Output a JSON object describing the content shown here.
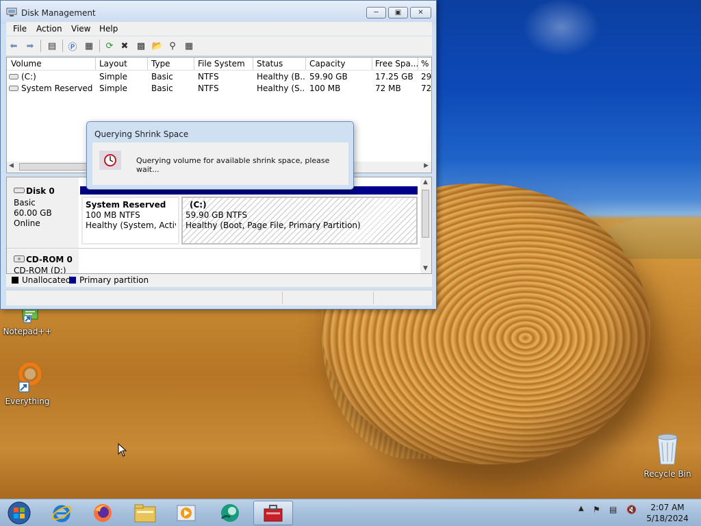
{
  "window": {
    "title": "Disk Management",
    "menu": [
      "File",
      "Action",
      "View",
      "Help"
    ],
    "columns": [
      "Volume",
      "Layout",
      "Type",
      "File System",
      "Status",
      "Capacity",
      "Free Spa...",
      "% F"
    ],
    "volumes": [
      {
        "volume": "(C:)",
        "layout": "Simple",
        "type": "Basic",
        "fs": "NTFS",
        "status": "Healthy (B...",
        "capacity": "59.90 GB",
        "free": "17.25 GB",
        "pct": "29"
      },
      {
        "volume": "System Reserved",
        "layout": "Simple",
        "type": "Basic",
        "fs": "NTFS",
        "status": "Healthy (S...",
        "capacity": "100 MB",
        "free": "72 MB",
        "pct": "72"
      }
    ],
    "disks": [
      {
        "name": "Disk 0",
        "kind": "Basic",
        "size": "60.00 GB",
        "state": "Online",
        "partitions": [
          {
            "name": "System Reserved",
            "size": "100 MB NTFS",
            "status": "Healthy (System, Active,"
          },
          {
            "name": "(C:)",
            "size": "59.90 GB NTFS",
            "status": "Healthy (Boot, Page File, Primary Partition)"
          }
        ]
      },
      {
        "name": "CD-ROM 0",
        "kind": "CD-ROM (D:)"
      }
    ],
    "legend": [
      {
        "label": "Unallocated",
        "color": "#000000"
      },
      {
        "label": "Primary partition",
        "color": "#00008b"
      }
    ]
  },
  "dialog": {
    "title": "Querying Shrink Space",
    "message": "Querying volume for available shrink space, please wait..."
  },
  "desktop_icons": [
    {
      "label": "Notepad++",
      "icon": "notepadpp-icon"
    },
    {
      "label": "Everything",
      "icon": "everything-icon"
    },
    {
      "label": "Recycle Bin",
      "icon": "recycle-bin-icon"
    }
  ],
  "taskbar": {
    "apps": [
      "start-orb-icon",
      "internet-explorer-icon",
      "firefox-icon",
      "file-explorer-icon",
      "media-player-icon",
      "greenshot-icon",
      "computer-management-icon"
    ],
    "clock_time": "2:07 AM",
    "clock_date": "5/18/2024"
  },
  "colors": {
    "title_bar": "#c9daf0",
    "primary_partition": "#00008b",
    "taskbar": "#a6c0dc"
  }
}
